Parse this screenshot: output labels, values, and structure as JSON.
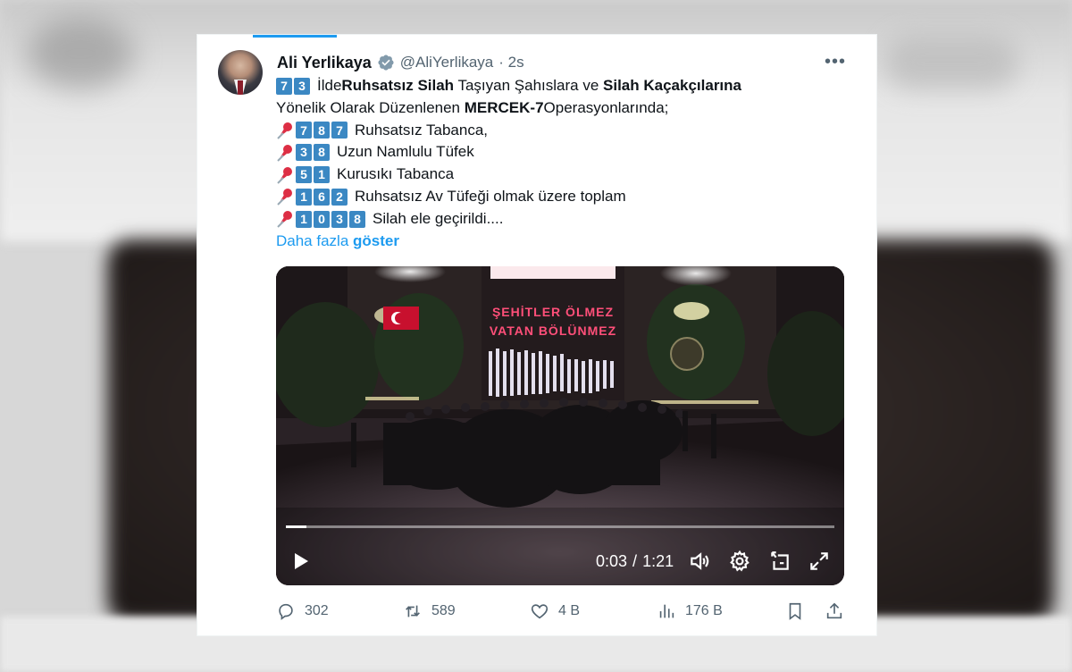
{
  "tweet": {
    "author": {
      "name": "Ali Yerlikaya",
      "handle": "@AliYerlikaya",
      "time": "· 2s"
    },
    "more_label": "•••",
    "lines": {
      "l1": {
        "keycaps": [
          "7",
          "3"
        ],
        "t1": "İlde ",
        "b1": "Ruhsatsız Silah",
        "t2": " Taşıyan Şahıslara ve ",
        "b2": "Silah Kaçakçılarına"
      },
      "l2": {
        "t1": "Yönelik Olarak Düzenlenen ",
        "b1": "MERCEK-7",
        "t2": " Operasyonlarında;"
      },
      "items": [
        {
          "keycaps": [
            "7",
            "8",
            "7"
          ],
          "text": "Ruhsatsız Tabanca,"
        },
        {
          "keycaps": [
            "3",
            "8"
          ],
          "text": "Uzun Namlulu Tüfek"
        },
        {
          "keycaps": [
            "5",
            "1"
          ],
          "text": "Kurusıkı Tabanca"
        },
        {
          "keycaps": [
            "1",
            "6",
            "2"
          ],
          "text": "Ruhsatsız Av Tüfeği olmak üzere toplam"
        },
        {
          "keycaps": [
            "1",
            "0",
            "3",
            "8"
          ],
          "text": "Silah ele geçirildi...."
        }
      ],
      "show_more": {
        "t1": "Daha fazla ",
        "b1": "göster"
      }
    },
    "video": {
      "sign_line1": "ŞEHİTLER ÖLMEZ",
      "sign_line2": "VATAN BÖLÜNMEZ",
      "current_time": "0:03",
      "separator": "/",
      "duration": "1:21",
      "progress_fraction": 0.037
    },
    "actions": {
      "replies": "302",
      "reposts": "589",
      "likes": "4 B",
      "views": "176 B"
    },
    "colors": {
      "accent": "#1d9bf0",
      "text": "#0f1419",
      "muted": "#536471",
      "keycap": "#3b88c3"
    }
  }
}
